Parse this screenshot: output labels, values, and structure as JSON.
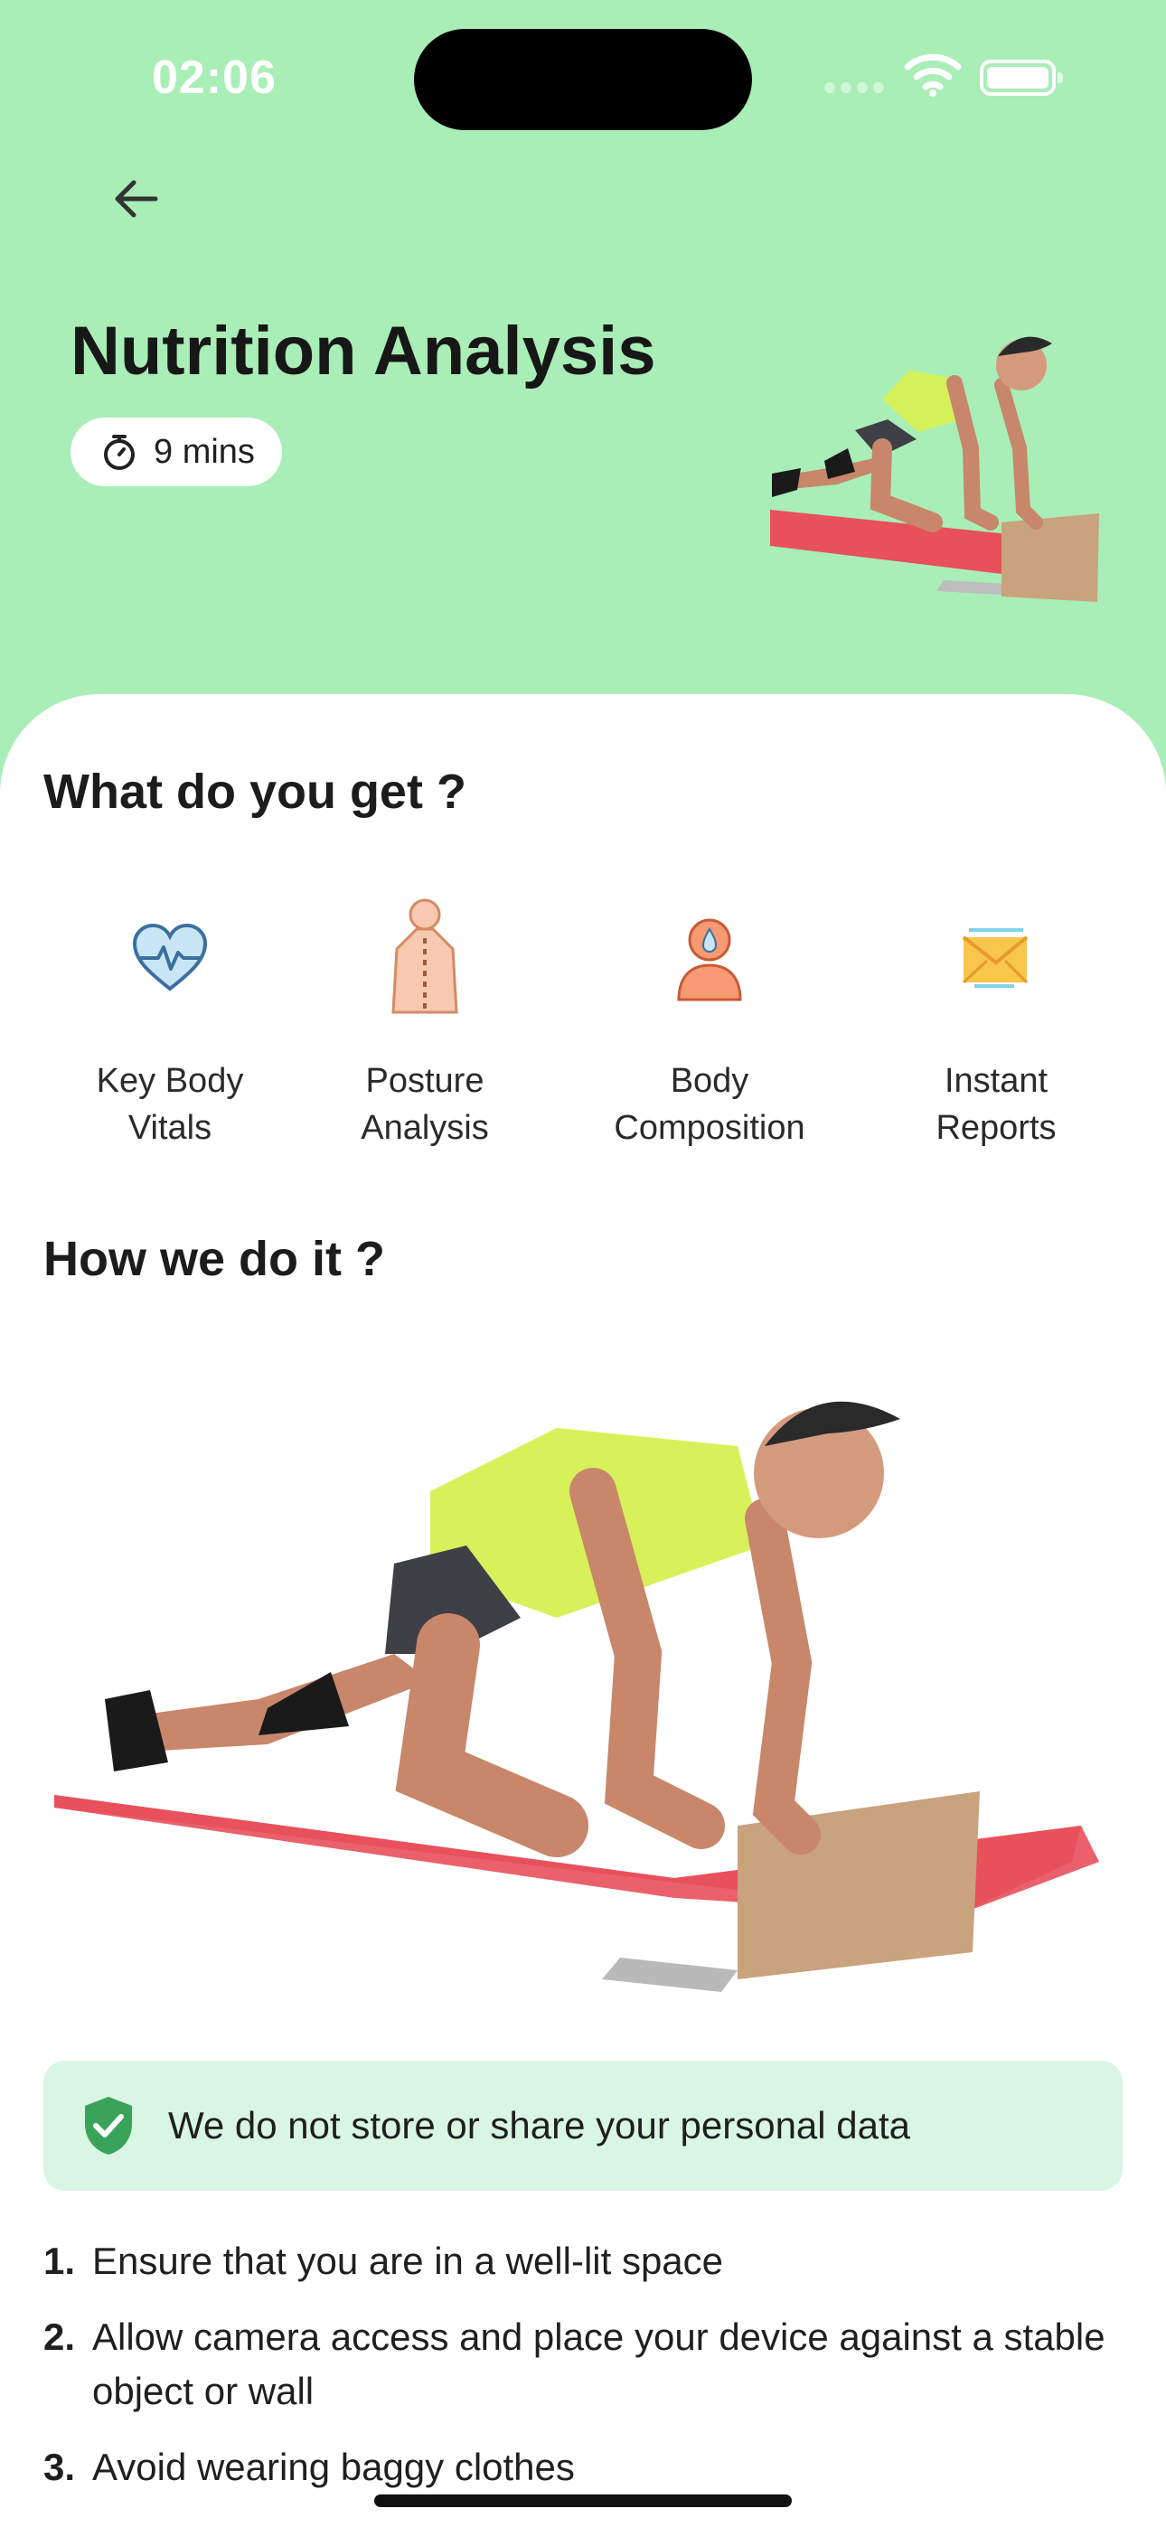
{
  "status_bar": {
    "time": "02:06"
  },
  "header": {
    "title": "Nutrition Analysis",
    "duration": "9 mins"
  },
  "what_you_get": {
    "heading": "What do you get ?",
    "items": [
      {
        "label": "Key Body\nVitals",
        "icon": "heart-pulse-icon"
      },
      {
        "label": "Posture\nAnalysis",
        "icon": "spine-icon"
      },
      {
        "label": "Body\nComposition",
        "icon": "body-composition-icon"
      },
      {
        "label": "Instant\nReports",
        "icon": "report-icon"
      }
    ]
  },
  "how_we_do_it": {
    "heading": "How we do it ?",
    "privacy_note": "We do not store or share your personal data",
    "steps": [
      {
        "num": "1.",
        "text": "Ensure that you are in a well-lit space"
      },
      {
        "num": "2.",
        "text": "Allow camera access and place your device against a stable object or wall"
      },
      {
        "num": "3.",
        "text": "Avoid wearing baggy clothes"
      }
    ]
  },
  "colors": {
    "header_bg": "#a8eeb6",
    "privacy_bg": "#d9f5e3",
    "shield": "#3aa35a",
    "mat": "#e8505b"
  }
}
